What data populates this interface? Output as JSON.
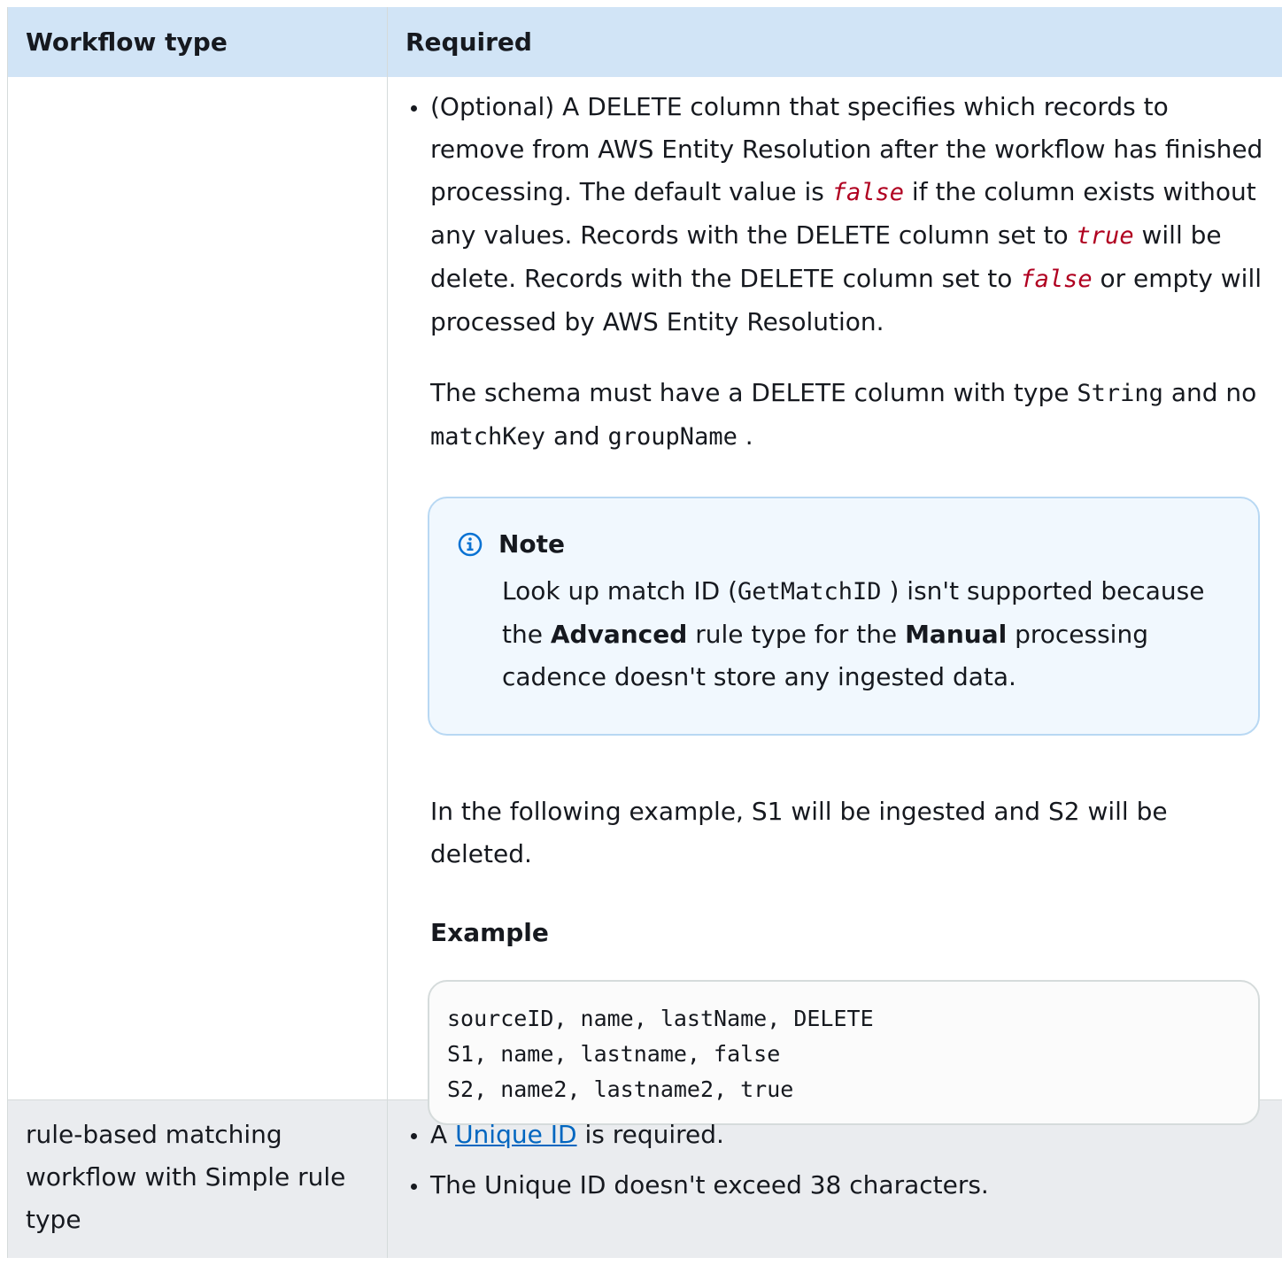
{
  "header": {
    "col1": "Workflow type",
    "col2": "Required"
  },
  "row1": {
    "bullet_text_1": "(Optional) A DELETE column that specifies which records to remove from AWS Entity Resolution after the workflow has finished processing. The default value is ",
    "code_false": "false",
    "bullet_text_2": " if the column exists without any values. Records with the DELETE column set to ",
    "code_true": "true",
    "bullet_text_3": " will be delete. Records with the DELETE column set to ",
    "bullet_text_4": " or empty will processed by AWS Entity Resolution.",
    "schema_text_1": "The schema must have a DELETE column with type ",
    "schema_code_string": "String",
    "schema_text_2": " and no ",
    "schema_code_matchkey": "matchKey",
    "schema_text_3": " and ",
    "schema_code_groupname": "groupName",
    "schema_text_4": " .",
    "note": {
      "title": "Note",
      "text_1": "Look up match ID (",
      "code": "GetMatchID",
      "text_2": " ) isn't supported because the ",
      "bold_1": "Advanced",
      "text_3": " rule type for the ",
      "bold_2": "Manual",
      "text_4": " processing cadence doesn't store any ingested data."
    },
    "example_intro": "In the following example, S1 will be ingested and S2 will be deleted.",
    "example_title": "Example",
    "code_lines": [
      "sourceID, name, lastName, DELETE",
      "S1, name, lastname, false",
      "S2, name2, lastname2, true"
    ]
  },
  "row2": {
    "workflow_type": "rule-based matching workflow with Simple rule type",
    "bullet1_prefix": "A ",
    "bullet1_link": "Unique ID",
    "bullet1_suffix": " is required.",
    "bullet2": "The Unique ID doesn't exceed 38 characters."
  },
  "colors": {
    "header_bg": "#d1e4f6",
    "note_bg": "#f1f8fe",
    "note_border": "#b8d8f3",
    "code_red": "#b00020",
    "link": "#0066c0",
    "last_row_bg": "#eaecef"
  }
}
